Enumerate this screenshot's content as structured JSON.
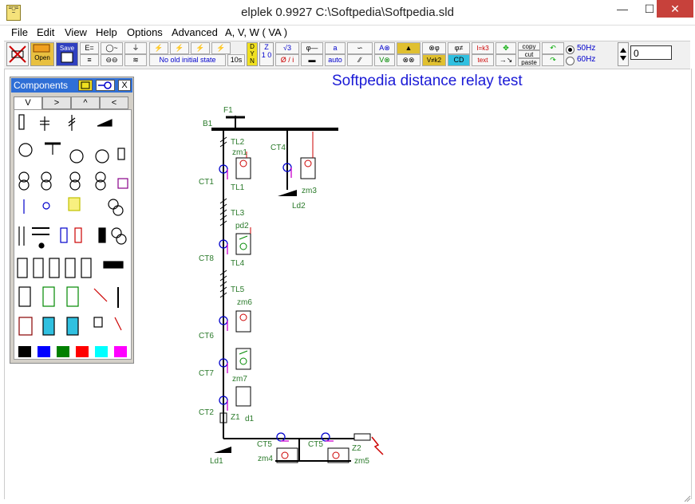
{
  "window": {
    "title": "elplek 0.9927     C:\\Softpedia\\Softpedia.sld",
    "minimize": "—",
    "maximize": "☐",
    "close": "✕"
  },
  "menu": [
    {
      "label": "File"
    },
    {
      "label": "Edit"
    },
    {
      "label": "View"
    },
    {
      "label": "Help"
    },
    {
      "label": "Options"
    },
    {
      "label": "Advanced"
    },
    {
      "label": "A, V, W ( VA )"
    }
  ],
  "toolbar": {
    "open_label": "Open",
    "save_label": "Save",
    "initial_state": "No old initial state",
    "time_label": "10s",
    "dyn_label": "D Y N",
    "sqrt3_label": "√3",
    "ratio_label": "Ø / i",
    "a_label": "a",
    "auto_label": "auto",
    "ikb_label": "I=k3",
    "text_label": "text",
    "copy_label": "copy",
    "cut_label": "cut",
    "paste_label": "paste",
    "freq_50": "50Hz",
    "freq_60": "60Hz",
    "freq_selected": "50Hz",
    "value_input": "0"
  },
  "panel": {
    "title": "Components",
    "close": "X",
    "tabs": [
      {
        "label": "V",
        "active": true
      },
      {
        "label": ">",
        "active": false
      },
      {
        "label": "^",
        "active": false
      },
      {
        "label": "<",
        "active": false
      }
    ],
    "colors": [
      "#000000",
      "#0000ff",
      "#008000",
      "#ff0000",
      "#00ffff",
      "#ff00ff"
    ]
  },
  "drawing": {
    "title": "Softpedia distance relay test",
    "labels": {
      "F1": "F1",
      "B1": "B1",
      "TL2": "TL2",
      "zm1": "zm1",
      "CT4": "CT4",
      "CT1": "CT1",
      "TL1": "TL1",
      "zm3": "zm3",
      "Ld2": "Ld2",
      "TL3": "TL3",
      "pd2": "pd2",
      "CT8": "CT8",
      "TL4": "TL4",
      "TL5": "TL5",
      "zm6": "zm6",
      "CT6": "CT6",
      "CT7": "CT7",
      "zm7": "zm7",
      "CT2": "CT2",
      "Z1": "Z1",
      "d1": "d1",
      "CT5a": "CT5",
      "CT5b": "CT5",
      "Z2": "Z2",
      "Ld1": "Ld1",
      "zm4": "zm4",
      "zm5": "zm5"
    }
  }
}
